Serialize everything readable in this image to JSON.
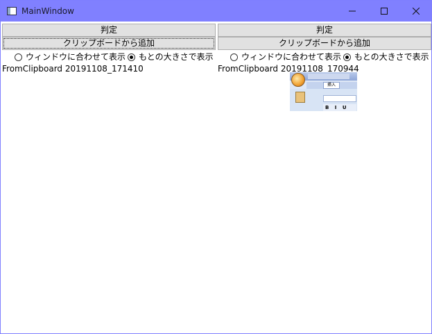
{
  "window": {
    "title": "MainWindow",
    "titlebar_color": "#8080ff",
    "controls": [
      "minimize-icon",
      "maximize-icon",
      "close-icon"
    ]
  },
  "panels": [
    {
      "judge_label": "判定",
      "paste_label": "クリップボードから追加",
      "radio_fit_label": "ウィンドウに合わせて表示",
      "radio_fit_checked": false,
      "radio_original_label": "もとの大きさで表示",
      "radio_original_checked": true,
      "source_label": "FromClipboard 20191108_171410",
      "has_image": false
    },
    {
      "judge_label": "判定",
      "paste_label": "クリップボードから追加",
      "radio_fit_label": "ウィンドウに合わせて表示",
      "radio_fit_checked": false,
      "radio_original_label": "もとの大きさで表示",
      "radio_original_checked": true,
      "source_label": "FromClipboard 20191108_170944",
      "has_image": true,
      "image_description_icon": "office-ribbon-screenshot-icon",
      "image_tab_text": "挿入",
      "image_format_text": "B I U"
    }
  ]
}
